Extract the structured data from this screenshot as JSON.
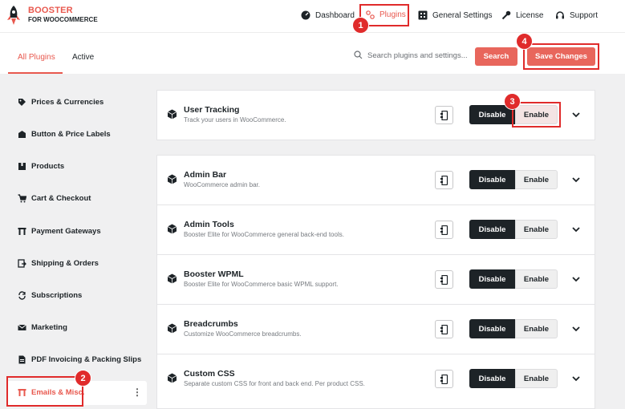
{
  "brand": {
    "line1": "BOOSTER",
    "line2": "FOR WOOCOMMERCE"
  },
  "nav": {
    "dashboard": "Dashboard",
    "plugins": "Plugins",
    "general_settings": "General Settings",
    "license": "License",
    "support": "Support"
  },
  "tabs": {
    "all": "All Plugins",
    "active": "Active"
  },
  "search": {
    "placeholder": "Search plugins and settings...",
    "button": "Search"
  },
  "save_button": "Save Changes",
  "sidebar": {
    "items": [
      {
        "label": "Prices & Currencies",
        "icon": "price-tag-icon"
      },
      {
        "label": "Button & Price Labels",
        "icon": "label-icon"
      },
      {
        "label": "Products",
        "icon": "box-icon"
      },
      {
        "label": "Cart & Checkout",
        "icon": "cart-icon"
      },
      {
        "label": "Payment Gateways",
        "icon": "gateway-icon"
      },
      {
        "label": "Shipping & Orders",
        "icon": "shipping-icon"
      },
      {
        "label": "Subscriptions",
        "icon": "refresh-icon"
      },
      {
        "label": "Marketing",
        "icon": "envelope-icon"
      },
      {
        "label": "PDF Invoicing & Packing Slips",
        "icon": "pdf-icon"
      },
      {
        "label": "Emails & Misc.",
        "icon": "emails-misc-icon"
      }
    ],
    "active_index": 9
  },
  "plugins": [
    {
      "title": "User Tracking",
      "desc": "Track your users in WooCommerce.",
      "disable": "Disable",
      "enable": "Enable"
    },
    {
      "title": "Admin Bar",
      "desc": "WooCommerce admin bar.",
      "disable": "Disable",
      "enable": "Enable"
    },
    {
      "title": "Admin Tools",
      "desc": "Booster Elite for WooCommerce general back-end tools.",
      "disable": "Disable",
      "enable": "Enable"
    },
    {
      "title": "Booster WPML",
      "desc": "Booster Elite for WooCommerce basic WPML support.",
      "disable": "Disable",
      "enable": "Enable"
    },
    {
      "title": "Breadcrumbs",
      "desc": "Customize WooCommerce breadcrumbs.",
      "disable": "Disable",
      "enable": "Enable"
    },
    {
      "title": "Custom CSS",
      "desc": "Separate custom CSS for front and back end. Per product CSS.",
      "disable": "Disable",
      "enable": "Enable"
    }
  ],
  "annotations": [
    "1",
    "2",
    "3",
    "4"
  ],
  "colors": {
    "accent": "#e8584e",
    "dark_button": "#1d2327",
    "annotation": "#e02b2b"
  }
}
